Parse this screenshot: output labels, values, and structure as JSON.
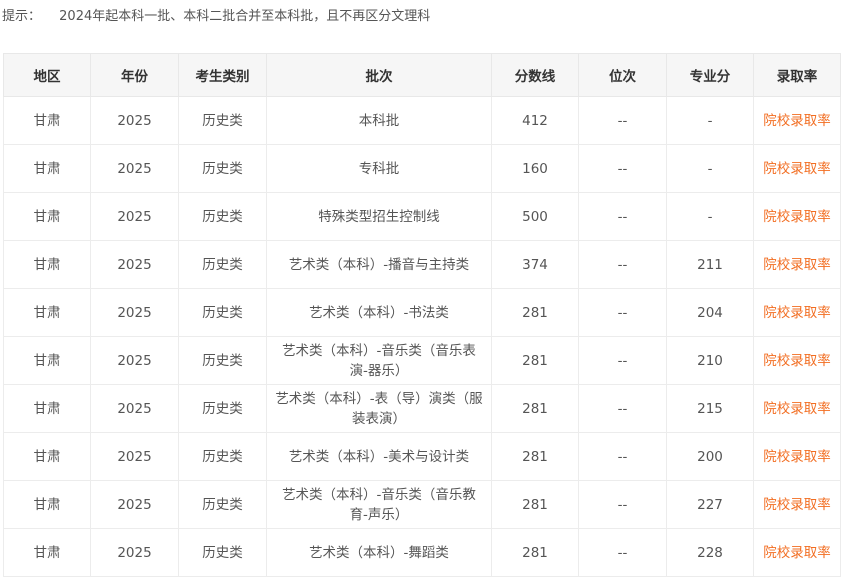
{
  "tip": {
    "label": "提示：",
    "text": "2024年起本科一批、本科二批合并至本科批，且不再区分文理科"
  },
  "table": {
    "headers": [
      "地区",
      "年份",
      "考生类别",
      "批次",
      "分数线",
      "位次",
      "专业分",
      "录取率"
    ],
    "rows": [
      {
        "region": "甘肃",
        "year": "2025",
        "category": "历史类",
        "batch": "本科批",
        "score": "412",
        "rank": "--",
        "major_score": "-",
        "rate": "院校录取率"
      },
      {
        "region": "甘肃",
        "year": "2025",
        "category": "历史类",
        "batch": "专科批",
        "score": "160",
        "rank": "--",
        "major_score": "-",
        "rate": "院校录取率"
      },
      {
        "region": "甘肃",
        "year": "2025",
        "category": "历史类",
        "batch": "特殊类型招生控制线",
        "score": "500",
        "rank": "--",
        "major_score": "-",
        "rate": "院校录取率"
      },
      {
        "region": "甘肃",
        "year": "2025",
        "category": "历史类",
        "batch": "艺术类（本科）-播音与主持类",
        "score": "374",
        "rank": "--",
        "major_score": "211",
        "rate": "院校录取率"
      },
      {
        "region": "甘肃",
        "year": "2025",
        "category": "历史类",
        "batch": "艺术类（本科）-书法类",
        "score": "281",
        "rank": "--",
        "major_score": "204",
        "rate": "院校录取率"
      },
      {
        "region": "甘肃",
        "year": "2025",
        "category": "历史类",
        "batch": "艺术类（本科）-音乐类（音乐表演-器乐）",
        "score": "281",
        "rank": "--",
        "major_score": "210",
        "rate": "院校录取率"
      },
      {
        "region": "甘肃",
        "year": "2025",
        "category": "历史类",
        "batch": "艺术类（本科）-表（导）演类（服装表演）",
        "score": "281",
        "rank": "--",
        "major_score": "215",
        "rate": "院校录取率"
      },
      {
        "region": "甘肃",
        "year": "2025",
        "category": "历史类",
        "batch": "艺术类（本科）-美术与设计类",
        "score": "281",
        "rank": "--",
        "major_score": "200",
        "rate": "院校录取率"
      },
      {
        "region": "甘肃",
        "year": "2025",
        "category": "历史类",
        "batch": "艺术类（本科）-音乐类（音乐教育-声乐）",
        "score": "281",
        "rank": "--",
        "major_score": "227",
        "rate": "院校录取率"
      },
      {
        "region": "甘肃",
        "year": "2025",
        "category": "历史类",
        "batch": "艺术类（本科）-舞蹈类",
        "score": "281",
        "rank": "--",
        "major_score": "228",
        "rate": "院校录取率"
      }
    ]
  }
}
